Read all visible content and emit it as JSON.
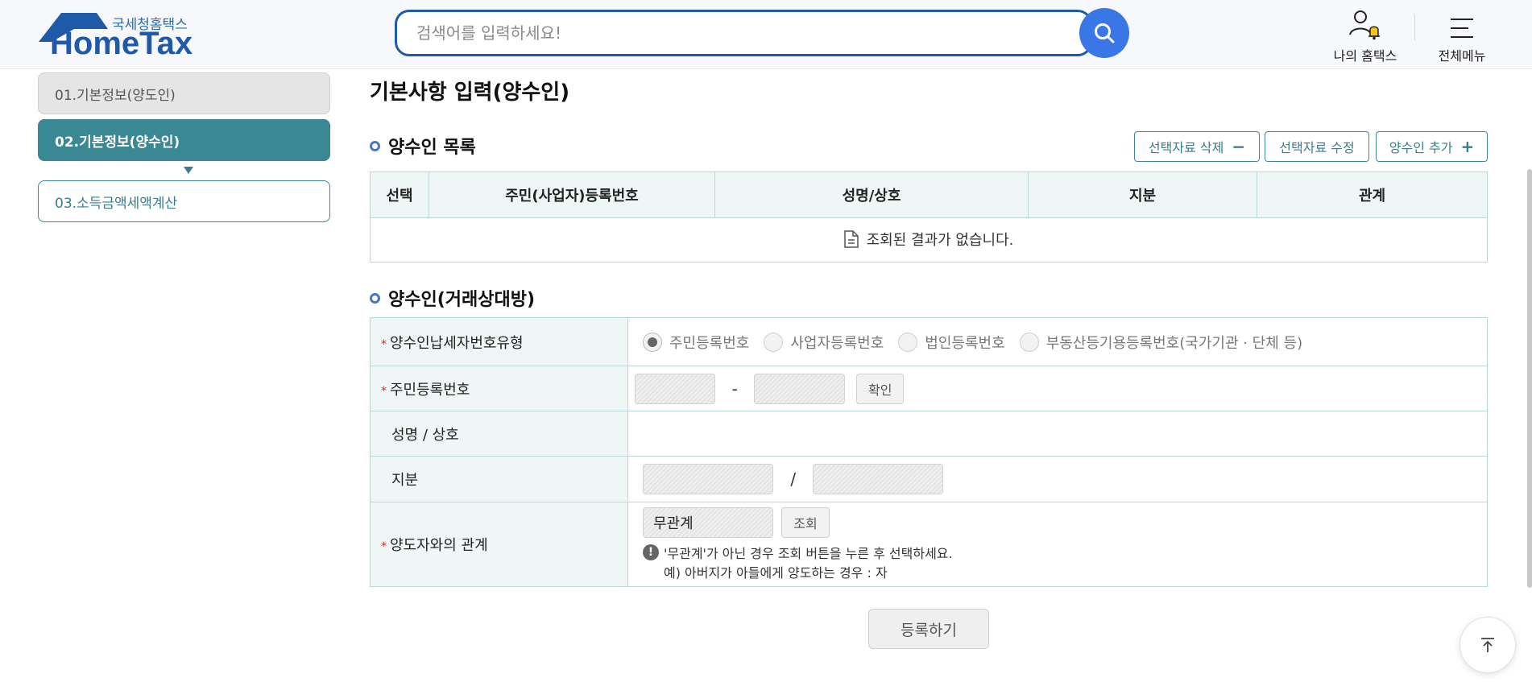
{
  "header": {
    "logo_sub": "국세청홈택스",
    "logo_main": "HomeTax",
    "search_placeholder": "검색어를 입력하세요!",
    "my_hometax": "나의 홈택스",
    "all_menu": "전체메뉴"
  },
  "sidebar": {
    "steps": [
      {
        "label": "01.기본정보(양도인)",
        "state": "done"
      },
      {
        "label": "02.기본정보(양수인)",
        "state": "active"
      },
      {
        "label": "03.소득금액세액계산",
        "state": "next"
      }
    ]
  },
  "main": {
    "page_title": "기본사항 입력(양수인)",
    "list_section": {
      "title": "양수인 목록",
      "buttons": {
        "delete": "선택자료 삭제",
        "delete_sym": "−",
        "modify": "선택자료 수정",
        "add": "양수인 추가",
        "add_sym": "+"
      },
      "columns": [
        "선택",
        "주민(사업자)등록번호",
        "성명/상호",
        "지분",
        "관계"
      ],
      "empty_text": "조회된 결과가 없습니다."
    },
    "form_section": {
      "title": "양수인(거래상대방)",
      "type_label": "양수인납세자번호유형",
      "type_options": [
        "주민등록번호",
        "사업자등록번호",
        "법인등록번호",
        "부동산등기용등록번호(국가기관 · 단체 등)"
      ],
      "type_selected": "주민등록번호",
      "id_label": "주민등록번호",
      "id_separator": "-",
      "id_confirm": "확인",
      "name_label": "성명 / 상호",
      "share_label": "지분",
      "share_separator": "/",
      "relation_label": "양도자와의 관계",
      "relation_value": "무관계",
      "relation_lookup": "조회",
      "relation_note_1": "'무관계'가 아닌 경우 조회 버튼을 누른 후 선택하세요.",
      "relation_note_2": "예) 아버지가 아들에게 양도하는 경우 : 자"
    },
    "submit": "등록하기"
  },
  "colors": {
    "brand": "#1e5aa8",
    "accent_teal": "#3a8893",
    "search_btn": "#3a77e6",
    "required": "#d42b2b"
  }
}
